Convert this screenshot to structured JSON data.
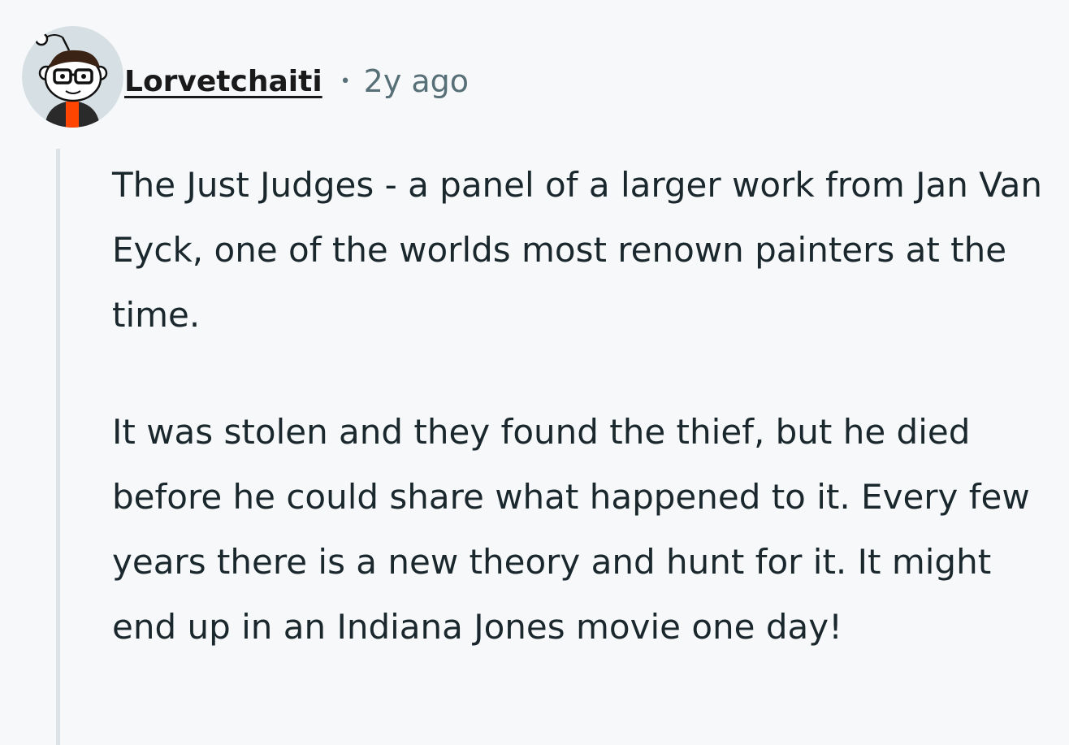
{
  "comment": {
    "avatar": {
      "icon": "snoo-avatar-icon",
      "colors": {
        "background": "#d6dfe3",
        "glasses": "#111111",
        "shirt": "#ff4500",
        "jacket": "#2a2a2a"
      }
    },
    "author": "Lorvetchaiti",
    "separator": "•",
    "time": "2y ago",
    "body": [
      "The Just Judges - a panel of a larger work from Jan Van Eyck, one of the worlds most renown painters at the time.",
      "It was stolen and they found the thief, but he died before he could share what happened to it. Every few years there is a new theory and hunt for it. It might end up in an Indiana Jones movie one day!"
    ]
  }
}
